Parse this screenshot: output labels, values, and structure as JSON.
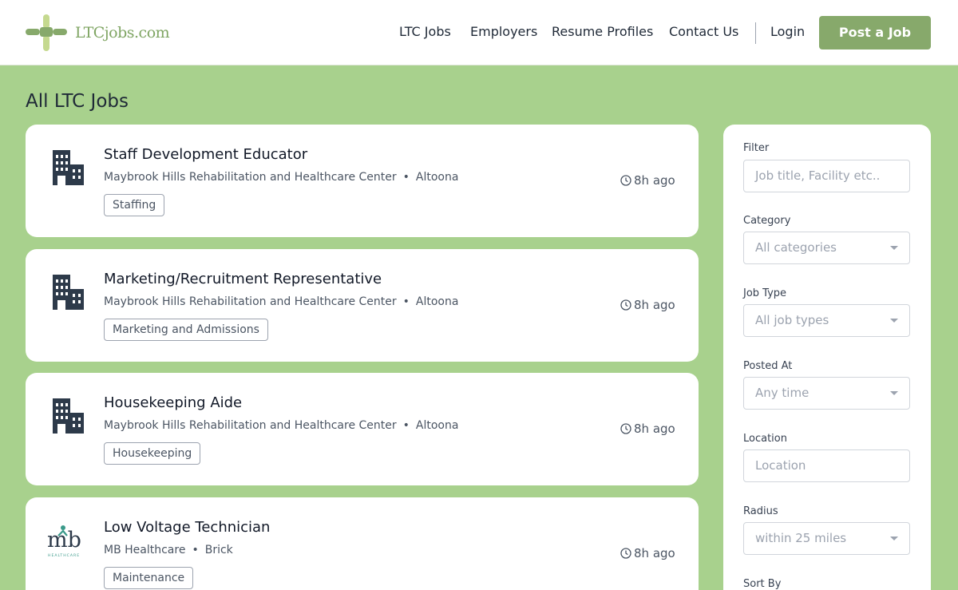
{
  "brand": {
    "name": "LTCjobs.com"
  },
  "nav": {
    "items": [
      "LTC Jobs",
      "Employers",
      "Resume Profiles",
      "Contact Us"
    ],
    "login": "Login",
    "post_job": "Post a Job"
  },
  "page": {
    "title": "All LTC Jobs"
  },
  "jobs": [
    {
      "title": "Staff Development Educator",
      "company": "Maybrook Hills Rehabilitation and Healthcare Center",
      "location": "Altoona",
      "tag": "Staffing",
      "posted": "8h ago",
      "logo": "building-icon"
    },
    {
      "title": "Marketing/Recruitment Representative",
      "company": "Maybrook Hills Rehabilitation and Healthcare Center",
      "location": "Altoona",
      "tag": "Marketing and Admissions",
      "posted": "8h ago",
      "logo": "building-icon"
    },
    {
      "title": "Housekeeping Aide",
      "company": "Maybrook Hills Rehabilitation and Healthcare Center",
      "location": "Altoona",
      "tag": "Housekeeping",
      "posted": "8h ago",
      "logo": "building-icon"
    },
    {
      "title": "Low Voltage Technician",
      "company": "MB Healthcare",
      "location": "Brick",
      "tag": "Maintenance",
      "posted": "8h ago",
      "logo": "mb-healthcare-logo"
    }
  ],
  "filters": {
    "filter": {
      "label": "Filter",
      "placeholder": "Job title, Facility etc.."
    },
    "category": {
      "label": "Category",
      "value": "All categories"
    },
    "job_type": {
      "label": "Job Type",
      "value": "All job types"
    },
    "posted_at": {
      "label": "Posted At",
      "value": "Any time"
    },
    "location": {
      "label": "Location",
      "placeholder": "Location"
    },
    "radius": {
      "label": "Radius",
      "value": "within 25 miles"
    },
    "sort_by": {
      "label": "Sort By"
    }
  },
  "colors": {
    "accent": "#87a96b",
    "background": "#a8d18d",
    "logo_green": "#7fa563",
    "logo_light": "#c5d98f"
  }
}
